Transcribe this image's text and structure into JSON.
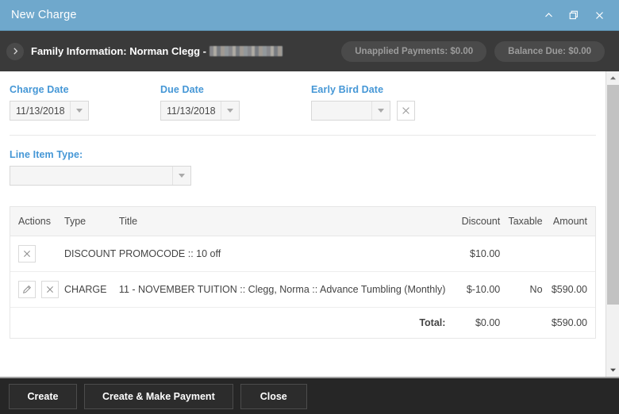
{
  "window": {
    "title": "New Charge",
    "controls": [
      {
        "name": "collapse-icon",
        "glyph": "chevron-up"
      },
      {
        "name": "restore-icon",
        "glyph": "restore"
      },
      {
        "name": "close-icon",
        "glyph": "close"
      }
    ]
  },
  "subheader": {
    "expander_icon": "chevron-right-icon",
    "family_label": "Family Information: Norman Clegg -",
    "redacted": true,
    "badges": [
      {
        "label": "Unapplied Payments: $0.00"
      },
      {
        "label": "Balance Due: $0.00"
      }
    ]
  },
  "form": {
    "charge_date": {
      "label": "Charge Date",
      "value": "11/13/2018",
      "placeholder": ""
    },
    "due_date": {
      "label": "Due Date",
      "value": "11/13/2018",
      "placeholder": ""
    },
    "early_bird_date": {
      "label": "Early Bird Date",
      "value": "",
      "placeholder": "",
      "clear_icon": "close-icon"
    },
    "line_item_type": {
      "label": "Line Item Type:",
      "value": "",
      "placeholder": ""
    }
  },
  "table": {
    "headers": {
      "actions": "Actions",
      "type": "Type",
      "title": "Title",
      "discount": "Discount",
      "taxable": "Taxable",
      "amount": "Amount"
    },
    "rows": [
      {
        "actions": [
          "delete"
        ],
        "type": "DISCOUNT",
        "title": "PROMOCODE :: 10 off",
        "discount": "$10.00",
        "taxable": "",
        "amount": ""
      },
      {
        "actions": [
          "edit",
          "delete"
        ],
        "type": "CHARGE",
        "title": "11 - NOVEMBER TUITION :: Clegg, Norma :: Advance Tumbling (Monthly)",
        "discount": "$-10.00",
        "taxable": "No",
        "amount": "$590.00"
      }
    ],
    "total": {
      "label": "Total:",
      "discount": "$0.00",
      "amount": "$590.00"
    }
  },
  "footer": {
    "create_label": "Create",
    "create_payment_label": "Create & Make Payment",
    "close_label": "Close"
  },
  "colors": {
    "titlebar": "#6FA8CC",
    "subheader": "#3A3A3A",
    "footer": "#262626",
    "label_blue": "#4597D6"
  }
}
